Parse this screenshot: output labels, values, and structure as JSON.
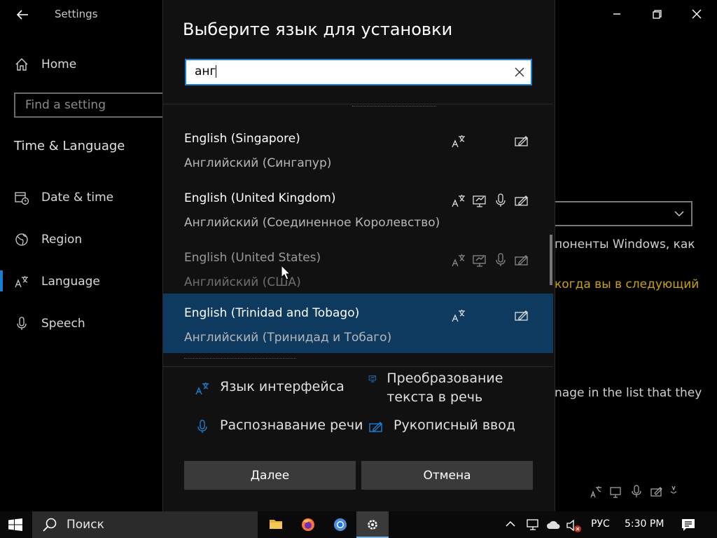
{
  "window": {
    "title": "Settings"
  },
  "sidebar": {
    "home_label": "Home",
    "find_placeholder": "Find a setting",
    "section_title": "Time & Language",
    "items": [
      {
        "label": "Date & time"
      },
      {
        "label": "Region"
      },
      {
        "label": "Language"
      },
      {
        "label": "Speech"
      }
    ]
  },
  "background": {
    "line1": "поненты Windows, как",
    "line2": "когда вы в следующий",
    "line3": "nage in the list that they"
  },
  "dialog": {
    "title": "Выберите язык для установки",
    "search_value": "анг",
    "languages": [
      {
        "name": "English (Singapore)",
        "native": "Английский (Сингапур)",
        "features": [
          "display",
          "handwriting"
        ]
      },
      {
        "name": "English (United Kingdom)",
        "native": "Английский (Соединенное Королевство)",
        "features": [
          "display",
          "tts",
          "speech",
          "handwriting"
        ]
      },
      {
        "name": "English (United States)",
        "native": "Английский (США)",
        "features": [
          "display",
          "tts",
          "speech",
          "handwriting"
        ],
        "state": "installed-dim"
      },
      {
        "name": "English (Trinidad and Tobago)",
        "native": "Английский (Тринидад и Тобаго)",
        "features": [
          "display",
          "handwriting"
        ],
        "state": "selected"
      }
    ],
    "legend": {
      "display": "Язык интерфейса",
      "tts": "Преобразование текста в речь",
      "speech": "Распознавание речи",
      "handwriting": "Рукописный ввод"
    },
    "next_label": "Далее",
    "cancel_label": "Отмена"
  },
  "taskbar": {
    "search_label": "Поиск",
    "lang_indicator": "РУС",
    "time": "5:30 PM"
  },
  "colors": {
    "accent": "#1a7fd4",
    "selected_row": "#0e3a60",
    "background_link": "#c9a400"
  }
}
